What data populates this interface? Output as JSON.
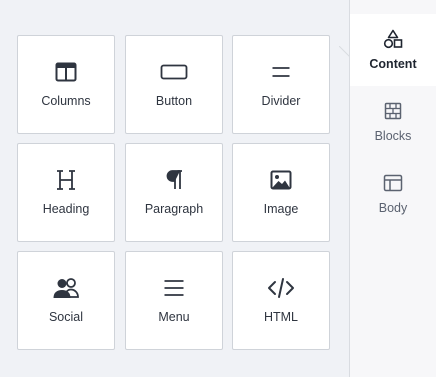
{
  "tools": [
    {
      "label": "Columns",
      "icon": "columns-icon"
    },
    {
      "label": "Button",
      "icon": "button-icon"
    },
    {
      "label": "Divider",
      "icon": "divider-icon"
    },
    {
      "label": "Heading",
      "icon": "heading-icon"
    },
    {
      "label": "Paragraph",
      "icon": "paragraph-icon"
    },
    {
      "label": "Image",
      "icon": "image-icon"
    },
    {
      "label": "Social",
      "icon": "social-icon"
    },
    {
      "label": "Menu",
      "icon": "menu-icon"
    },
    {
      "label": "HTML",
      "icon": "html-code-icon"
    }
  ],
  "side_tabs": [
    {
      "label": "Content",
      "icon": "shapes-icon",
      "active": true
    },
    {
      "label": "Blocks",
      "icon": "blocks-icon",
      "active": false
    },
    {
      "label": "Body",
      "icon": "body-layout-icon",
      "active": false
    }
  ],
  "colors": {
    "background": "#f0f2f6",
    "tile": "#ffffff",
    "icon": "#2f3540",
    "side_icon": "#5b6270"
  }
}
